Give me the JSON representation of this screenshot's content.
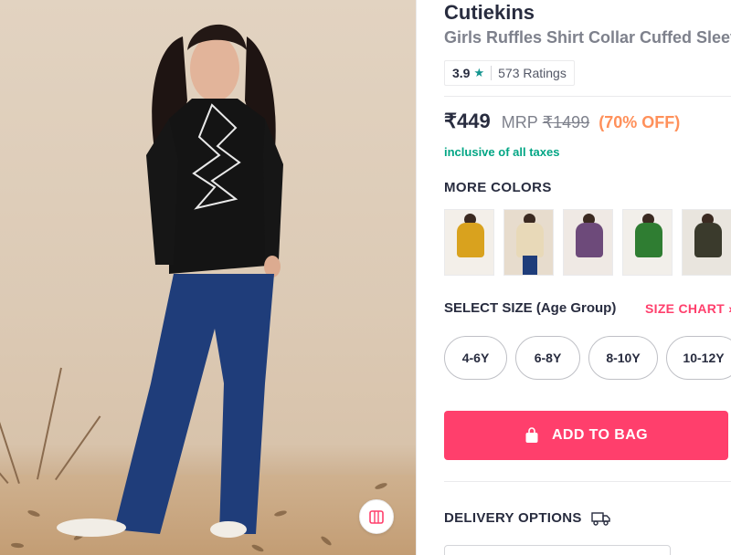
{
  "product": {
    "brand": "Cutiekins",
    "title": "Girls Ruffles Shirt Collar Cuffed Sleeves",
    "rating": {
      "value": "3.9",
      "star": "★",
      "count_label": "573 Ratings"
    },
    "price": {
      "selling": "₹449",
      "mrp_label": "MRP",
      "mrp": "₹1499",
      "discount": "(70% OFF)",
      "tax_note": "inclusive of all taxes"
    }
  },
  "colors": {
    "heading": "MORE COLORS",
    "swatches": [
      {
        "name": "mustard",
        "hex": "#d9a21e"
      },
      {
        "name": "cream-floral",
        "hex": "#e8d9b8"
      },
      {
        "name": "purple-floral",
        "hex": "#6d4a7a"
      },
      {
        "name": "green",
        "hex": "#2f7d32"
      },
      {
        "name": "dark-floral",
        "hex": "#3a3a2c"
      }
    ]
  },
  "sizes": {
    "heading": "SELECT SIZE (Age Group)",
    "chart_label": "SIZE CHART ›",
    "options": [
      "4-6Y",
      "6-8Y",
      "8-10Y",
      "10-12Y"
    ]
  },
  "actions": {
    "add_to_bag": "ADD TO BAG"
  },
  "delivery": {
    "heading": "DELIVERY OPTIONS"
  },
  "theme": {
    "accent": "#ff3f6c",
    "discount": "#ff905a",
    "tax": "#03a685",
    "rating_star": "#14958f"
  },
  "icons": [
    "bag-icon",
    "truck-icon",
    "view-similar-icon",
    "star-icon"
  ]
}
